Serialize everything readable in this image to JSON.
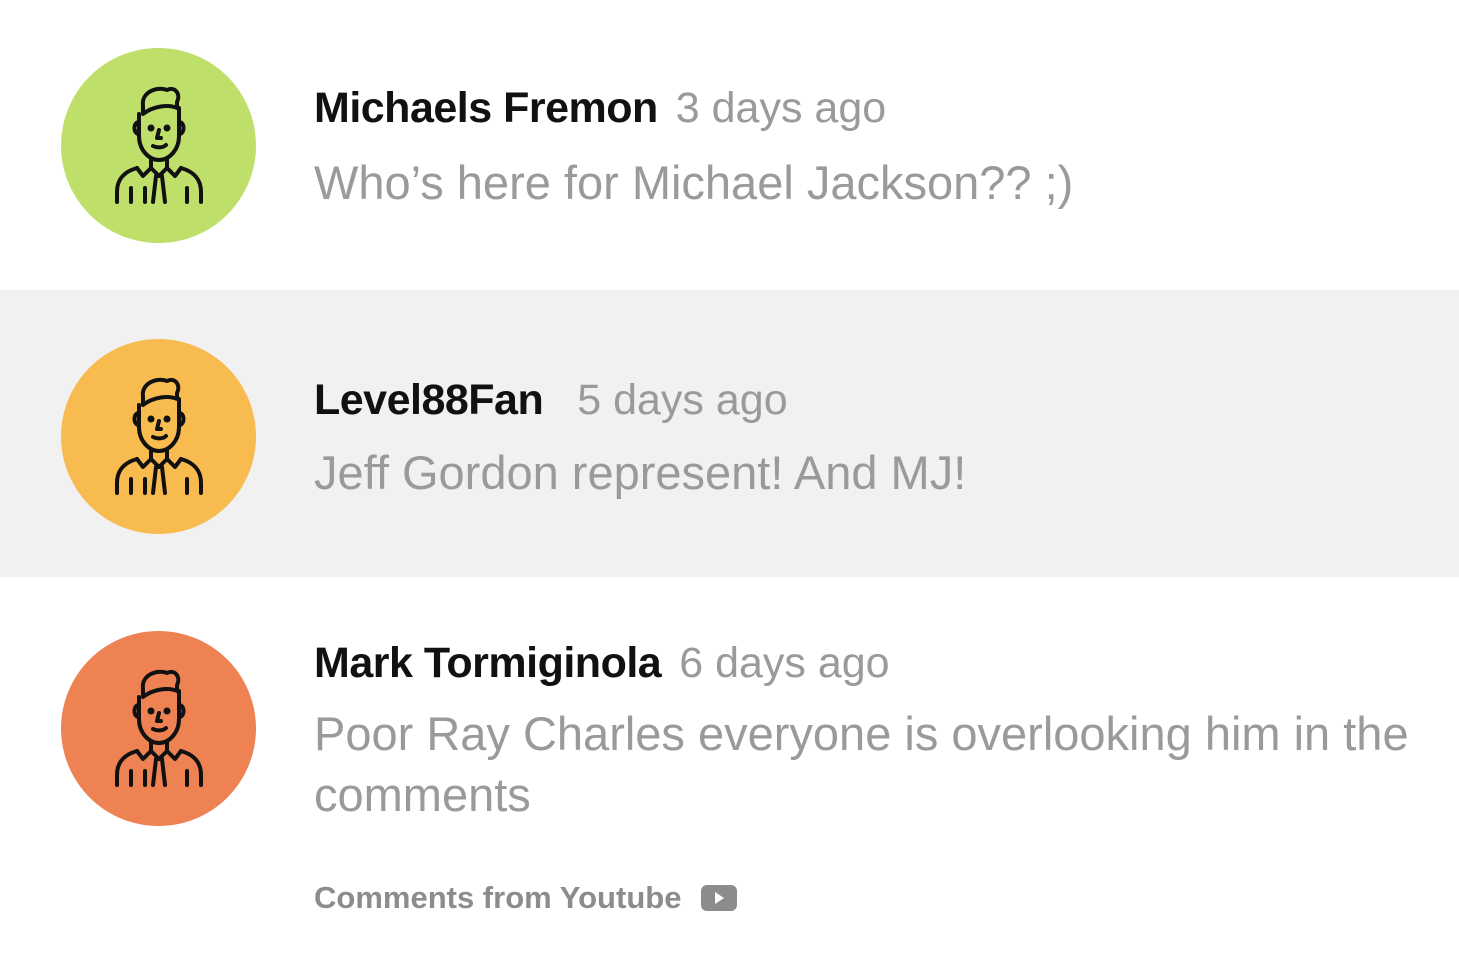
{
  "comments": [
    {
      "author": "Michaels Fremon",
      "time": "3 days ago",
      "text": "Who’s here for Michael Jackson?? ;)",
      "avatar_color": "#bedf6a",
      "avatar_icon": "man-avatar-icon"
    },
    {
      "author": "Level88Fan",
      "time": "5 days ago",
      "text": "Jeff Gordon represent! And MJ!",
      "avatar_color": "#f8bb4f",
      "avatar_icon": "man-avatar-icon"
    },
    {
      "author": "Mark Tormiginola",
      "time": "6 days ago",
      "text": "Poor Ray Charles everyone is overlooking him in the comments",
      "avatar_color": "#ef8253",
      "avatar_icon": "man-avatar-icon"
    }
  ],
  "footer": {
    "label": "Comments from Youtube",
    "icon": "youtube-icon"
  },
  "colors": {
    "highlight_row": "#f1f1f1",
    "muted_text": "#9a9a9c",
    "author_text": "#111111"
  }
}
